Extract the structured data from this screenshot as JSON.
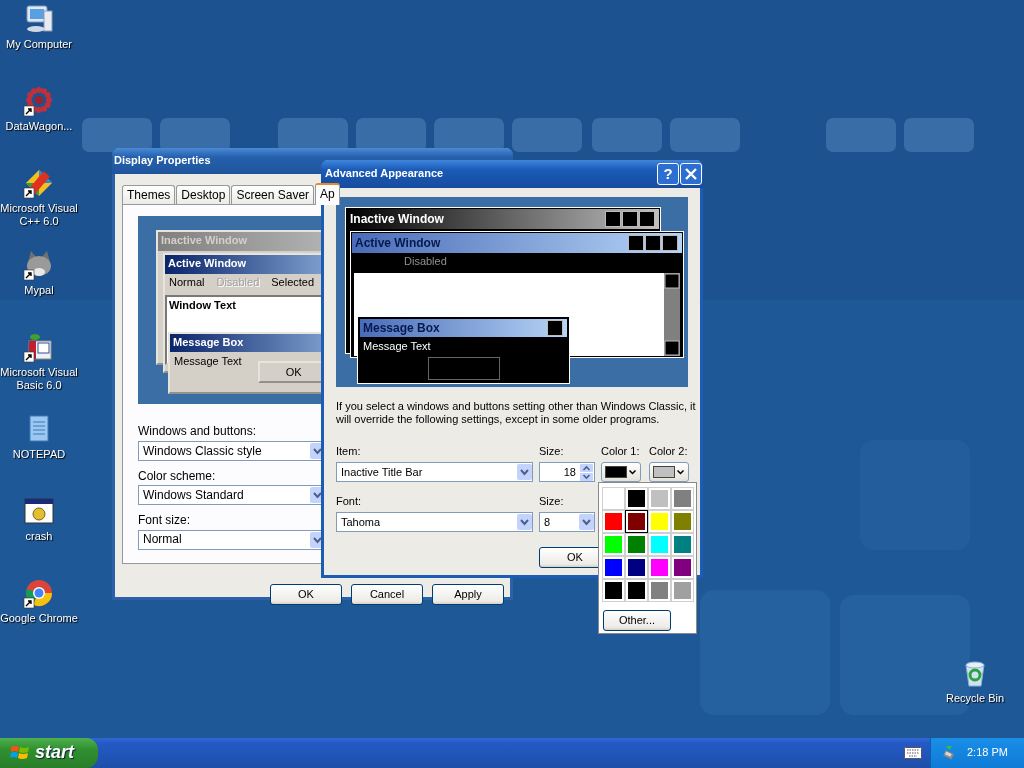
{
  "desktop_icons": [
    {
      "label": "My Computer",
      "kind": "computer",
      "shortcut": false
    },
    {
      "label": "DataWagon...",
      "kind": "datawagon",
      "shortcut": true
    },
    {
      "label": "Microsoft Visual C++ 6.0",
      "kind": "vcpp",
      "shortcut": true
    },
    {
      "label": "Mypal",
      "kind": "mypal",
      "shortcut": true
    },
    {
      "label": "Microsoft Visual Basic 6.0",
      "kind": "vb",
      "shortcut": true
    },
    {
      "label": "NOTEPAD",
      "kind": "notepad",
      "shortcut": false
    },
    {
      "label": "crash",
      "kind": "crash",
      "shortcut": false
    },
    {
      "label": "Google Chrome",
      "kind": "chrome",
      "shortcut": true
    },
    {
      "label": "Recycle Bin",
      "kind": "recycle",
      "shortcut": false
    }
  ],
  "display_properties": {
    "title": "Display Properties",
    "tabs": [
      {
        "label": "Themes",
        "selected": false
      },
      {
        "label": "Desktop",
        "selected": false
      },
      {
        "label": "Screen Saver",
        "selected": false
      },
      {
        "label": "Ap",
        "selected": true
      }
    ],
    "preview": {
      "inactive_title": "Inactive Window",
      "active_title": "Active Window",
      "menu": [
        {
          "label": "Normal",
          "disabled": false
        },
        {
          "label": "Disabled",
          "disabled": true
        },
        {
          "label": "Selected",
          "disabled": false
        }
      ],
      "window_text": "Window Text",
      "message_title": "Message Box",
      "message_text": "Message Text",
      "button": "OK"
    },
    "fields": [
      {
        "label": "Windows and buttons:",
        "value": "Windows Classic style"
      },
      {
        "label": "Color scheme:",
        "value": "Windows Standard"
      },
      {
        "label": "Font size:",
        "value": "Normal"
      }
    ],
    "buttons": [
      "OK",
      "Cancel",
      "Apply"
    ]
  },
  "advanced_appearance": {
    "title": "Advanced Appearance",
    "help": "?",
    "preview": {
      "inactive_title": "Inactive Window",
      "active_title": "Active Window",
      "menu": [
        {
          "label": "Disabled",
          "disabled": true
        }
      ],
      "message_title": "Message Box",
      "message_text": "Message Text"
    },
    "info": "If you select a windows and buttons setting other than Windows Classic, it will override the following settings, except in some older programs.",
    "item": {
      "label": "Item:",
      "value": "Inactive Title Bar"
    },
    "item_size": {
      "label": "Size:",
      "value": "18"
    },
    "color_buttons": [
      {
        "label": "Color 1:",
        "color": "#000000"
      },
      {
        "label": "Color 2:",
        "color": "#c0c0c0"
      }
    ],
    "font": {
      "label": "Font:",
      "value": "Tahoma"
    },
    "font_size": {
      "label": "Size:",
      "value": "8"
    },
    "buttons": [
      "OK"
    ]
  },
  "color_palette": {
    "swatches": [
      {
        "color": "#ffffff",
        "selected": false
      },
      {
        "color": "#000000",
        "selected": false
      },
      {
        "color": "#c0c0c0",
        "selected": false
      },
      {
        "color": "#808080",
        "selected": false
      },
      {
        "color": "#ff0000",
        "selected": false
      },
      {
        "color": "#800000",
        "selected": true
      },
      {
        "color": "#ffff00",
        "selected": false
      },
      {
        "color": "#808000",
        "selected": false
      },
      {
        "color": "#00ff00",
        "selected": false
      },
      {
        "color": "#008000",
        "selected": false
      },
      {
        "color": "#00ffff",
        "selected": false
      },
      {
        "color": "#008080",
        "selected": false
      },
      {
        "color": "#0000ff",
        "selected": false
      },
      {
        "color": "#000080",
        "selected": false
      },
      {
        "color": "#ff00ff",
        "selected": false
      },
      {
        "color": "#800080",
        "selected": false
      },
      {
        "color": "#000000",
        "selected": false
      },
      {
        "color": "#000000",
        "selected": false
      },
      {
        "color": "#808080",
        "selected": false
      },
      {
        "color": "#a0a0a0",
        "selected": false
      }
    ],
    "other_button": "Other..."
  },
  "taskbar": {
    "start": "start",
    "clock": "2:18 PM"
  }
}
